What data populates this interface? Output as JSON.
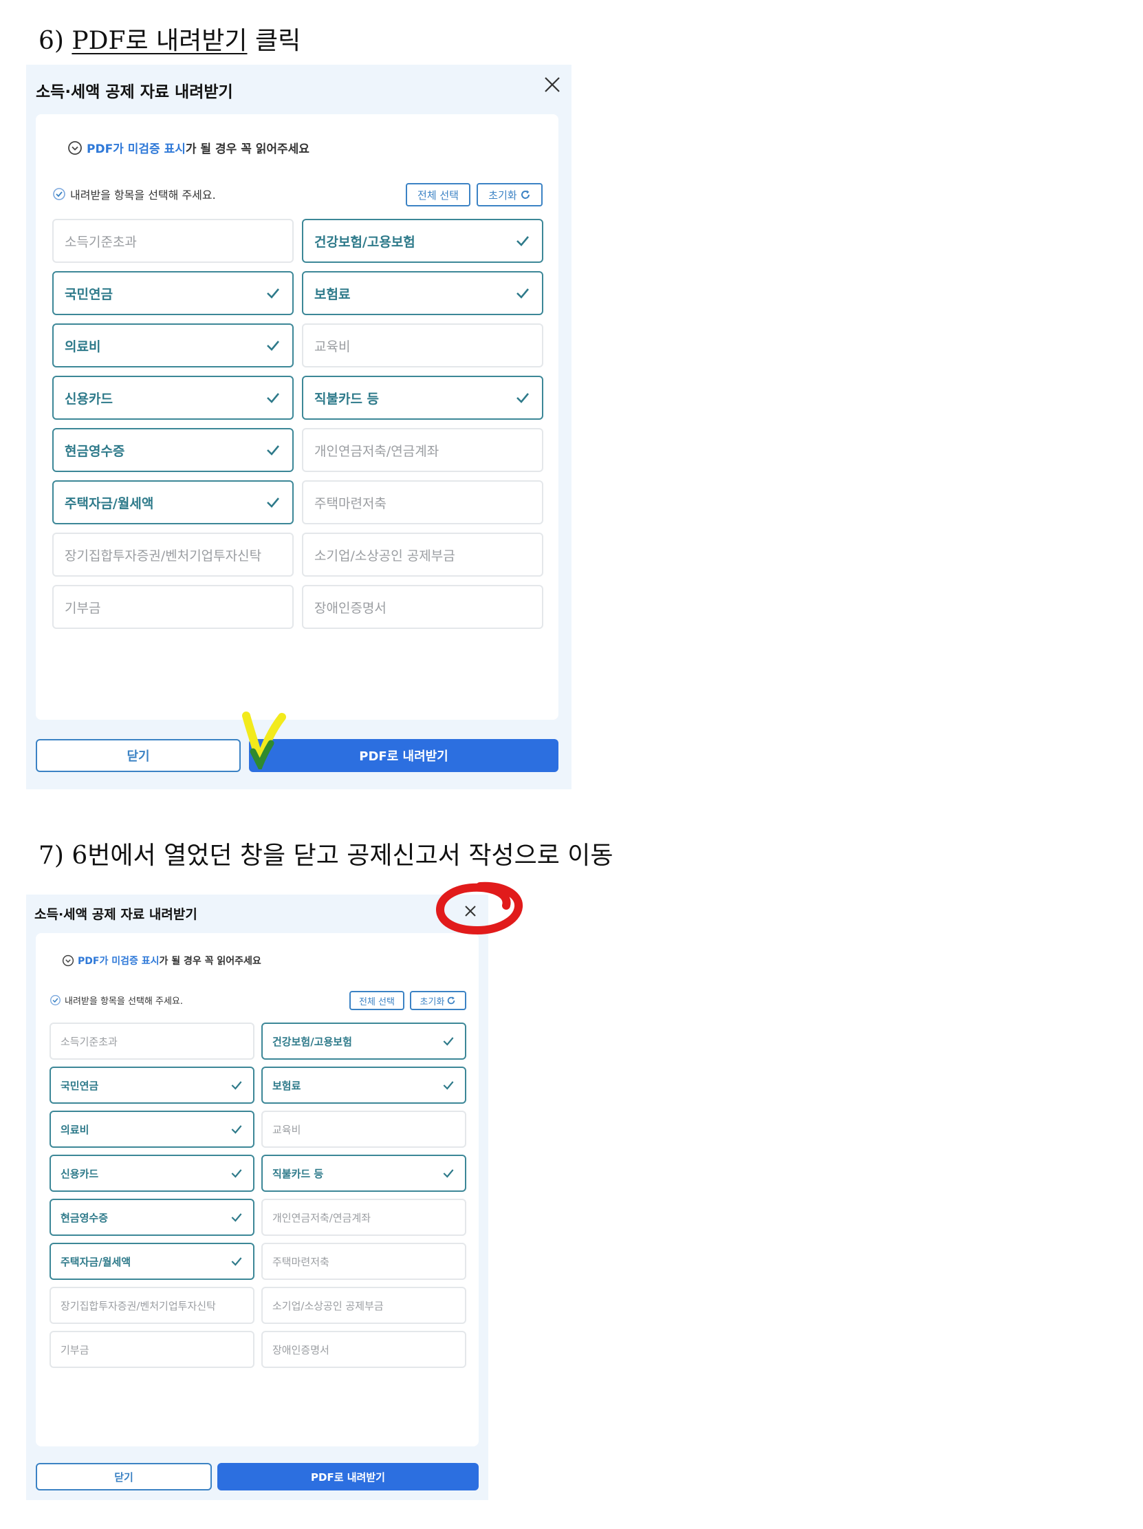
{
  "steps": [
    {
      "number": "6)",
      "action_label": "PDF로 내려받기",
      "suffix": "클릭",
      "dialog": {
        "title": "소득·세액 공제 자료 내려받기",
        "notice_highlight": "PDF가 미검증 표시",
        "notice_rest": "가 될 경우 꼭 읽어주세요",
        "instruction": "내려받을 항목을 선택해 주세요.",
        "select_all_label": "전체 선택",
        "reset_label": "초기화",
        "items": [
          {
            "label": "소득기준초과",
            "checked": false
          },
          {
            "label": "건강보험/고용보험",
            "checked": true
          },
          {
            "label": "국민연금",
            "checked": true
          },
          {
            "label": "보험료",
            "checked": true
          },
          {
            "label": "의료비",
            "checked": true
          },
          {
            "label": "교육비",
            "checked": false
          },
          {
            "label": "신용카드",
            "checked": true
          },
          {
            "label": "직불카드 등",
            "checked": true
          },
          {
            "label": "현금영수증",
            "checked": true
          },
          {
            "label": "개인연금저축/연금계좌",
            "checked": false
          },
          {
            "label": "주택자금/월세액",
            "checked": true
          },
          {
            "label": "주택마련저축",
            "checked": false
          },
          {
            "label": "장기집합투자증권/벤처기업투자신탁",
            "checked": false
          },
          {
            "label": "소기업/소상공인 공제부금",
            "checked": false
          },
          {
            "label": "기부금",
            "checked": false
          },
          {
            "label": "장애인증명서",
            "checked": false
          }
        ],
        "close_label": "닫기",
        "pdf_label": "PDF로 내려받기"
      }
    },
    {
      "number": "7)",
      "text": "6번에서 열었던 창을 닫고 공제신고서 작성으로 이동",
      "dialog": {
        "title": "소득·세액 공제 자료 내려받기",
        "notice_highlight": "PDF가 미검증 표시",
        "notice_rest": "가 될 경우 꼭 읽어주세요",
        "instruction": "내려받을 항목을 선택해 주세요.",
        "select_all_label": "전체 선택",
        "reset_label": "초기화",
        "items": [
          {
            "label": "소득기준초과",
            "checked": false
          },
          {
            "label": "건강보험/고용보험",
            "checked": true
          },
          {
            "label": "국민연금",
            "checked": true
          },
          {
            "label": "보험료",
            "checked": true
          },
          {
            "label": "의료비",
            "checked": true
          },
          {
            "label": "교육비",
            "checked": false
          },
          {
            "label": "신용카드",
            "checked": true
          },
          {
            "label": "직불카드 등",
            "checked": true
          },
          {
            "label": "현금영수증",
            "checked": true
          },
          {
            "label": "개인연금저축/연금계좌",
            "checked": false
          },
          {
            "label": "주택자금/월세액",
            "checked": true
          },
          {
            "label": "주택마련저축",
            "checked": false
          },
          {
            "label": "장기집합투자증권/벤처기업투자신탁",
            "checked": false
          },
          {
            "label": "소기업/소상공인 공제부금",
            "checked": false
          },
          {
            "label": "기부금",
            "checked": false
          },
          {
            "label": "장애인증명서",
            "checked": false
          }
        ],
        "close_label": "닫기",
        "pdf_label": "PDF로 내려받기"
      }
    }
  ],
  "annotation_colors": {
    "checkmark_yellow": "#f2ea1c",
    "checkmark_green": "#2f8a2f",
    "close_circle_red": "#e11b1b"
  }
}
